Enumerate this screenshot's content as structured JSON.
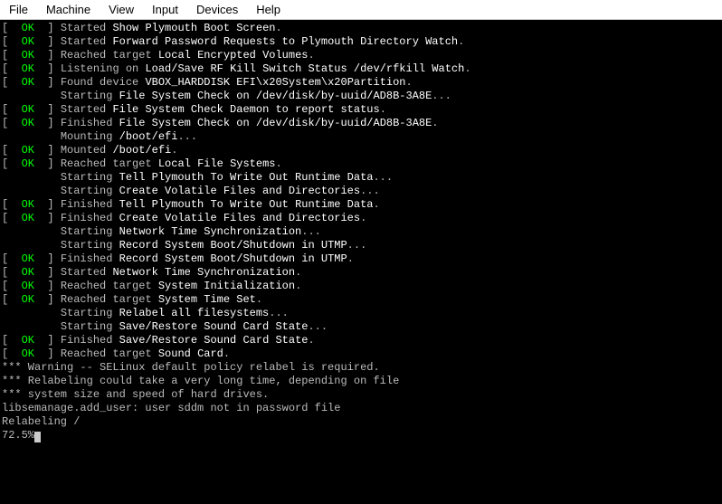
{
  "menu": {
    "items": [
      "File",
      "Machine",
      "View",
      "Input",
      "Devices",
      "Help"
    ]
  },
  "terminal": {
    "lines": [
      {
        "status": "OK",
        "action": "Started ",
        "unit": "Show Plymouth Boot Screen",
        "suffix": "."
      },
      {
        "status": "OK",
        "action": "Started ",
        "unit": "Forward Password Requests to Plymouth Directory Watch",
        "suffix": "."
      },
      {
        "status": "OK",
        "action": "Reached target ",
        "unit": "Local Encrypted Volumes",
        "suffix": "."
      },
      {
        "status": "OK",
        "action": "Listening on ",
        "unit": "Load/Save RF Kill Switch Status /dev/rfkill Watch",
        "suffix": "."
      },
      {
        "status": "OK",
        "action": "Found device ",
        "unit": "VBOX_HARDDISK EFI\\x20System\\x20Partition",
        "suffix": "."
      },
      {
        "status": null,
        "action": "Starting ",
        "unit": "File System Check on /dev/disk/by-uuid/AD8B-3A8E",
        "suffix": "..."
      },
      {
        "status": "OK",
        "action": "Started ",
        "unit": "File System Check Daemon to report status",
        "suffix": "."
      },
      {
        "status": "OK",
        "action": "Finished ",
        "unit": "File System Check on /dev/disk/by-uuid/AD8B-3A8E",
        "suffix": "."
      },
      {
        "status": null,
        "action": "Mounting ",
        "unit": "/boot/efi",
        "suffix": "..."
      },
      {
        "status": "OK",
        "action": "Mounted ",
        "unit": "/boot/efi",
        "suffix": "."
      },
      {
        "status": "OK",
        "action": "Reached target ",
        "unit": "Local File Systems",
        "suffix": "."
      },
      {
        "status": null,
        "action": "Starting ",
        "unit": "Tell Plymouth To Write Out Runtime Data",
        "suffix": "..."
      },
      {
        "status": null,
        "action": "Starting ",
        "unit": "Create Volatile Files and Directories",
        "suffix": "..."
      },
      {
        "status": "OK",
        "action": "Finished ",
        "unit": "Tell Plymouth To Write Out Runtime Data",
        "suffix": "."
      },
      {
        "status": "OK",
        "action": "Finished ",
        "unit": "Create Volatile Files and Directories",
        "suffix": "."
      },
      {
        "status": null,
        "action": "Starting ",
        "unit": "Network Time Synchronization",
        "suffix": "..."
      },
      {
        "status": null,
        "action": "Starting ",
        "unit": "Record System Boot/Shutdown in UTMP",
        "suffix": "..."
      },
      {
        "status": "OK",
        "action": "Finished ",
        "unit": "Record System Boot/Shutdown in UTMP",
        "suffix": "."
      },
      {
        "status": "OK",
        "action": "Started ",
        "unit": "Network Time Synchronization",
        "suffix": "."
      },
      {
        "status": "OK",
        "action": "Reached target ",
        "unit": "System Initialization",
        "suffix": "."
      },
      {
        "status": "OK",
        "action": "Reached target ",
        "unit": "System Time Set",
        "suffix": "."
      },
      {
        "status": null,
        "action": "Starting ",
        "unit": "Relabel all filesystems",
        "suffix": "..."
      },
      {
        "status": null,
        "action": "Starting ",
        "unit": "Save/Restore Sound Card State",
        "suffix": "..."
      },
      {
        "status": "OK",
        "action": "Finished ",
        "unit": "Save/Restore Sound Card State",
        "suffix": "."
      },
      {
        "status": "OK",
        "action": "Reached target ",
        "unit": "Sound Card",
        "suffix": "."
      }
    ],
    "plain_lines": [
      "",
      "*** Warning -- SELinux default policy relabel is required.",
      "*** Relabeling could take a very long time, depending on file",
      "*** system size and speed of hard drives.",
      "libsemanage.add_user: user sddm not in password file",
      "Relabeling /",
      "72.5%"
    ]
  }
}
